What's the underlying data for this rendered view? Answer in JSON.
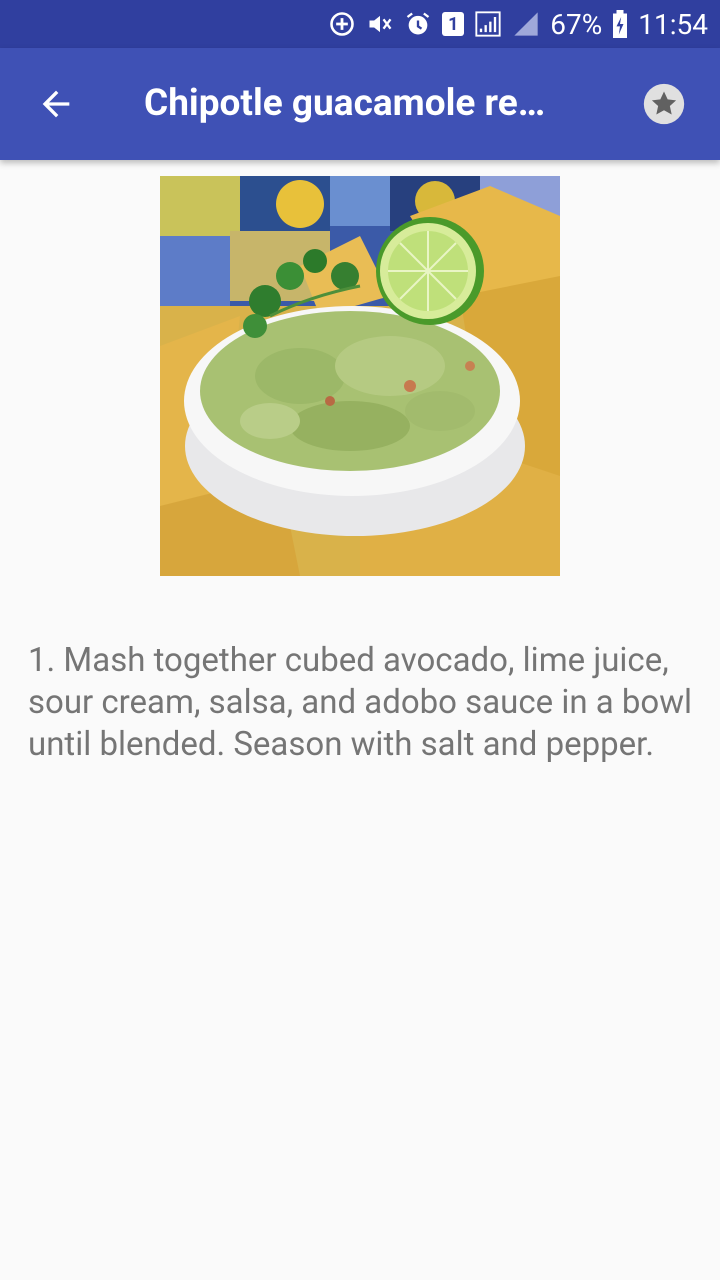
{
  "status_bar": {
    "battery": "67%",
    "time": "11:54",
    "sim_badge": "1",
    "icons": [
      "data-saver-icon",
      "mute-icon",
      "alarm-icon",
      "sim-icon",
      "signal-icon",
      "signal-icon-2",
      "battery-icon"
    ]
  },
  "app_bar": {
    "title": "Chipotle guacamole re…",
    "back_icon": "arrow-back-icon",
    "favorite_icon": "star-icon",
    "color": "#3f51b5",
    "status_color": "#303f9f"
  },
  "recipe": {
    "instructions": "1. Mash together cubed avocado, lime juice, sour cream, salsa, and adobo sauce in a bowl until blended. Season with salt and pepper."
  }
}
